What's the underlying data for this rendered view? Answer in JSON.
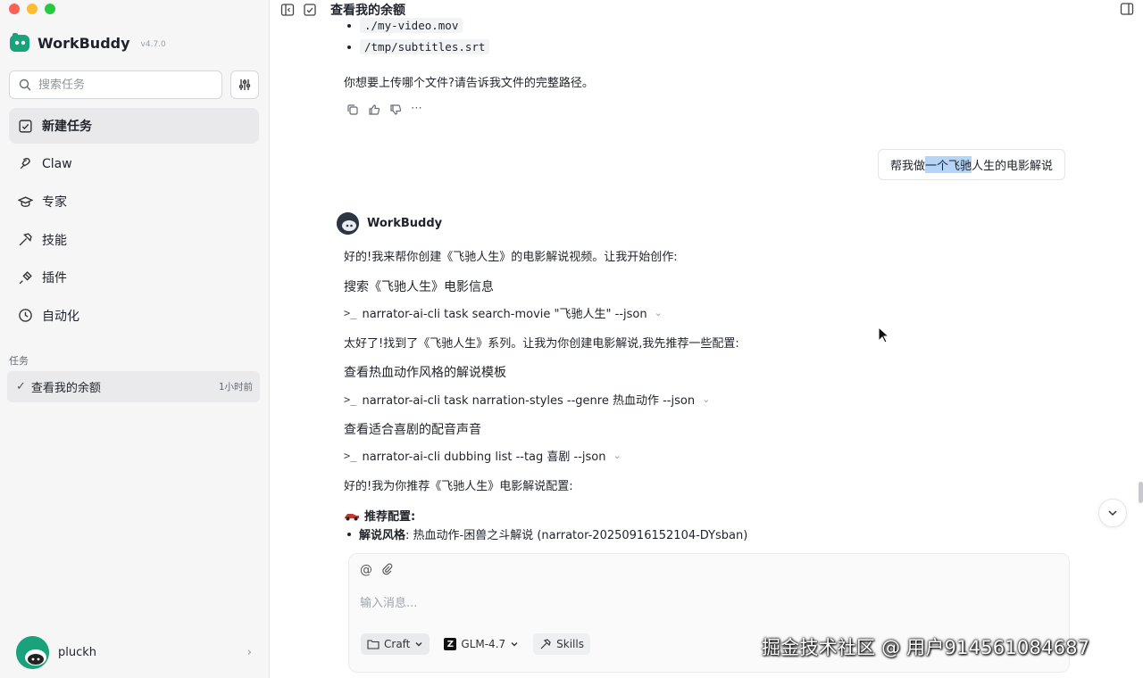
{
  "window": {
    "traffic_lights": [
      "close",
      "minimize",
      "maximize"
    ]
  },
  "brand": {
    "name": "WorkBuddy",
    "version": "v4.7.0",
    "color": "#1aa37a"
  },
  "search": {
    "placeholder": "搜索任务"
  },
  "nav": [
    {
      "id": "new-task",
      "label": "新建任务",
      "icon": "edit-square-icon",
      "active": true
    },
    {
      "id": "claw",
      "label": "Claw",
      "icon": "claw-icon",
      "active": false
    },
    {
      "id": "experts",
      "label": "专家",
      "icon": "graduation-cap-icon",
      "active": false
    },
    {
      "id": "skills",
      "label": "技能",
      "icon": "hammer-icon",
      "active": false
    },
    {
      "id": "plugins",
      "label": "插件",
      "icon": "plug-icon",
      "active": false
    },
    {
      "id": "automation",
      "label": "自动化",
      "icon": "clock-icon",
      "active": false
    }
  ],
  "tasks": {
    "section_label": "任务",
    "items": [
      {
        "title": "查看我的余额",
        "time": "1小时前",
        "selected": true
      }
    ]
  },
  "user": {
    "name": "pluckh"
  },
  "topbar": {
    "title": "查看我的余额"
  },
  "chat": {
    "prev_items": [
      "./my-video.mov",
      "/tmp/subtitles.srt"
    ],
    "prev_question": "你想要上传哪个文件?请告诉我文件的完整路径。",
    "user_message": {
      "before": "帮我做",
      "highlight": "一个飞驰",
      "after": "人生的电影解说"
    },
    "bot_name": "WorkBuddy",
    "lines": {
      "intro": "好的!我来帮你创建《飞驰人生》的电影解说视频。让我开始创作:",
      "step1_title": "搜索《飞驰人生》电影信息",
      "step1_cmd": "narrator-ai-cli task search-movie \"飞驰人生\" --json",
      "found": "太好了!找到了《飞驰人生》系列。让我为你创建电影解说,我先推荐一些配置:",
      "step2_title": "查看热血动作风格的解说模板",
      "step2_cmd": "narrator-ai-cli task narration-styles --genre 热血动作 --json",
      "step3_title": "查看适合喜剧的配音声音",
      "step3_cmd": "narrator-ai-cli dubbing list --tag 喜剧 --json",
      "recommend_intro": "好的!我为你推荐《飞驰人生》电影解说配置:",
      "recommend_title": "推荐配置:",
      "recommend_item_label": "解说风格",
      "recommend_item_value": ": 热血动作-困兽之斗解说 (narrator-20250916152104-DYsban)"
    },
    "prompt_symbol": ">_"
  },
  "composer": {
    "placeholder": "输入消息...",
    "mode_label": "Craft",
    "model_label": "GLM-4.7",
    "model_logo": "Z",
    "skills_label": "Skills"
  },
  "overlay": {
    "watermark_text": "掘金技术社区 @ 用户914561084687"
  }
}
